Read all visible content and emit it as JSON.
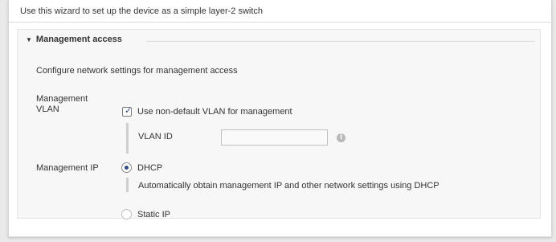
{
  "intro": {
    "text": "Use this wizard to set up the device as a simple layer-2 switch"
  },
  "section": {
    "title": "Management access",
    "description": "Configure network settings for management access",
    "vlan": {
      "label_line1": "Management",
      "label_line2": "VLAN",
      "checkbox_label": "Use non-default VLAN for management",
      "checked": true,
      "vlan_id_label": "VLAN ID",
      "vlan_id_value": "",
      "info_icon": "info-icon"
    },
    "ip": {
      "label": "Management IP",
      "dhcp_label": "DHCP",
      "dhcp_selected": true,
      "dhcp_help": "Automatically obtain management IP and other network settings using DHCP",
      "static_label": "Static IP",
      "static_selected": false
    }
  },
  "colors": {
    "accent": "#2b4d88",
    "panel_bg": "#ffffff",
    "section_bg": "#f7f7f7"
  }
}
